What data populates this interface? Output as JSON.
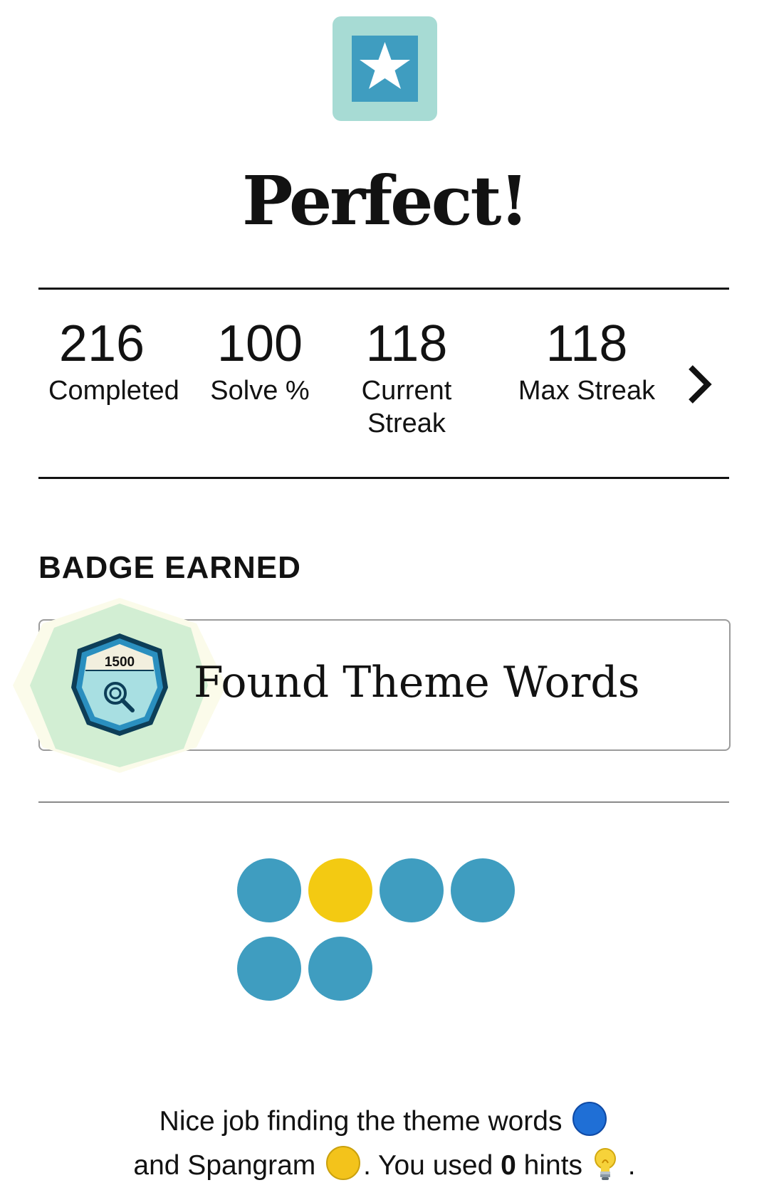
{
  "hero": {
    "icon": "star-icon",
    "title": "Perfect!"
  },
  "stats": [
    {
      "value": "216",
      "label": "Completed"
    },
    {
      "value": "100",
      "label": "Solve %"
    },
    {
      "value": "118",
      "label": "Current Streak"
    },
    {
      "value": "118",
      "label": "Max Streak"
    }
  ],
  "stats_more_icon": "chevron-right-icon",
  "badge": {
    "heading": "BADGE EARNED",
    "count": "1500",
    "name": "Found Theme Words",
    "icon": "magnifier-badge-icon"
  },
  "results": {
    "rows": [
      [
        "theme",
        "spangram",
        "theme",
        "theme"
      ],
      [
        "theme",
        "theme"
      ]
    ],
    "colors": {
      "theme": "#3f9dc0",
      "spangram": "#f3ca12"
    }
  },
  "message": {
    "line1_prefix": "Nice job finding the theme words",
    "line2_prefix": "and Spangram",
    "line2_mid": ". You used",
    "hints_count": "0",
    "line2_suffix": "hints",
    "line2_end": "."
  }
}
